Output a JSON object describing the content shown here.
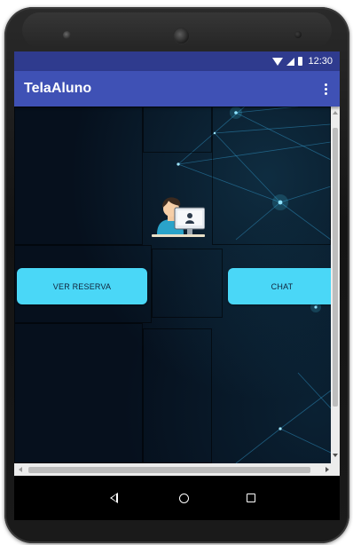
{
  "status_bar": {
    "time": "12:30",
    "icons": [
      "wifi-icon",
      "signal-icon",
      "battery-icon"
    ]
  },
  "app_bar": {
    "title": "TelaAluno",
    "menu_icon": "more-vert-icon"
  },
  "main": {
    "background_image": "network-lines",
    "avatar_icon": "student-at-computer-icon",
    "buttons": {
      "ver_reserva": "VER RESERVA",
      "chat": "CHAT"
    }
  },
  "navigation": {
    "items": [
      "back-icon",
      "home-icon",
      "recent-apps-icon"
    ]
  },
  "colors": {
    "status_bar": "#2f3b8e",
    "app_bar": "#3f51b5",
    "button": "#4ad7f7",
    "background": "#06101d"
  }
}
